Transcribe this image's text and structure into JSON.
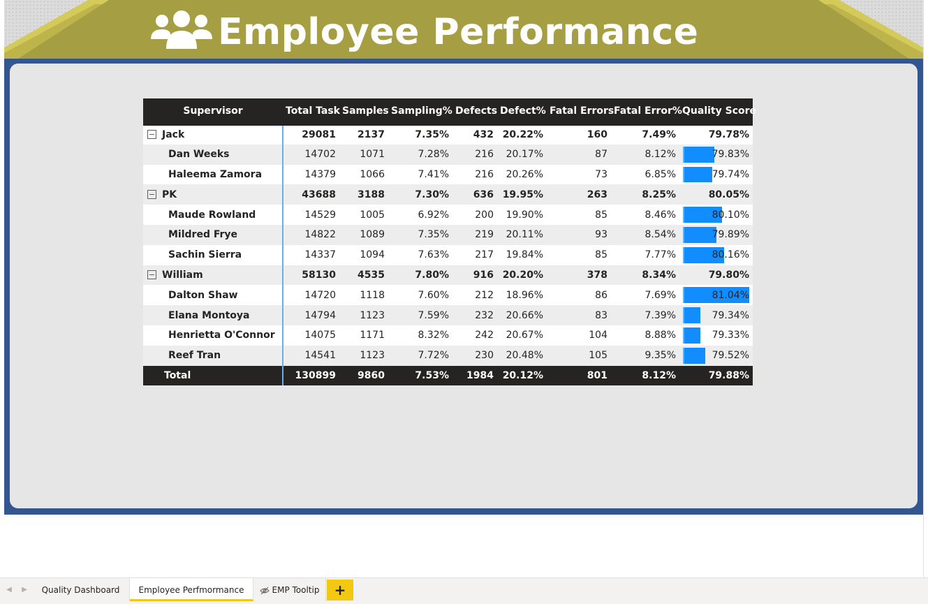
{
  "header": {
    "title": "Employee Performance",
    "icon": "people-group-icon",
    "colors": {
      "banner": "#a69e43",
      "banner_edge": "#d3ca5a",
      "frame": "#335590",
      "canvas": "#e6e6e6"
    }
  },
  "table": {
    "columns": [
      "Supervisor",
      "Total Task",
      "Samples",
      "Sampling%",
      "Defects",
      "Defect%",
      "Fatal Errors",
      "Fatal Error%",
      "Quality Score"
    ],
    "groups": [
      {
        "name": "Jack",
        "values": [
          "29081",
          "2137",
          "7.35%",
          "432",
          "20.22%",
          "160",
          "7.49%",
          "79.78%"
        ],
        "children": [
          {
            "name": "Dan Weeks",
            "values": [
              "14702",
              "1071",
              "7.28%",
              "216",
              "20.17%",
              "87",
              "8.12%",
              "79.83%"
            ],
            "quality_score": 79.83
          },
          {
            "name": "Haleema Zamora",
            "values": [
              "14379",
              "1066",
              "7.41%",
              "216",
              "20.26%",
              "73",
              "6.85%",
              "79.74%"
            ],
            "quality_score": 79.74
          }
        ]
      },
      {
        "name": "PK",
        "values": [
          "43688",
          "3188",
          "7.30%",
          "636",
          "19.95%",
          "263",
          "8.25%",
          "80.05%"
        ],
        "children": [
          {
            "name": "Maude Rowland",
            "values": [
              "14529",
              "1005",
              "6.92%",
              "200",
              "19.90%",
              "85",
              "8.46%",
              "80.10%"
            ],
            "quality_score": 80.1
          },
          {
            "name": "Mildred Frye",
            "values": [
              "14822",
              "1089",
              "7.35%",
              "219",
              "20.11%",
              "93",
              "8.54%",
              "79.89%"
            ],
            "quality_score": 79.89
          },
          {
            "name": "Sachin Sierra",
            "values": [
              "14337",
              "1094",
              "7.63%",
              "217",
              "19.84%",
              "85",
              "7.77%",
              "80.16%"
            ],
            "quality_score": 80.16
          }
        ]
      },
      {
        "name": "William",
        "values": [
          "58130",
          "4535",
          "7.80%",
          "916",
          "20.20%",
          "378",
          "8.34%",
          "79.80%"
        ],
        "children": [
          {
            "name": "Dalton Shaw",
            "values": [
              "14720",
              "1118",
              "7.60%",
              "212",
              "18.96%",
              "86",
              "7.69%",
              "81.04%"
            ],
            "quality_score": 81.04
          },
          {
            "name": "Elana Montoya",
            "values": [
              "14794",
              "1123",
              "7.59%",
              "232",
              "20.66%",
              "83",
              "7.39%",
              "79.34%"
            ],
            "quality_score": 79.34
          },
          {
            "name": "Henrietta O'Connor",
            "values": [
              "14075",
              "1171",
              "8.32%",
              "242",
              "20.67%",
              "104",
              "8.88%",
              "79.33%"
            ],
            "quality_score": 79.33
          },
          {
            "name": "Reef Tran",
            "values": [
              "14541",
              "1123",
              "7.72%",
              "230",
              "20.48%",
              "105",
              "9.35%",
              "79.52%"
            ],
            "quality_score": 79.52
          }
        ]
      }
    ],
    "total": {
      "label": "Total",
      "values": [
        "130899",
        "9860",
        "7.53%",
        "1984",
        "20.12%",
        "801",
        "8.12%",
        "79.88%"
      ]
    },
    "bar_color": "#118dff"
  },
  "tabs": {
    "items": [
      {
        "label": "Quality Dashboard",
        "active": false,
        "hidden": false
      },
      {
        "label": "Employee Perfmormance",
        "active": true,
        "hidden": false
      },
      {
        "label": "EMP Tooltip",
        "active": false,
        "hidden": true
      }
    ],
    "add_label": "+"
  }
}
